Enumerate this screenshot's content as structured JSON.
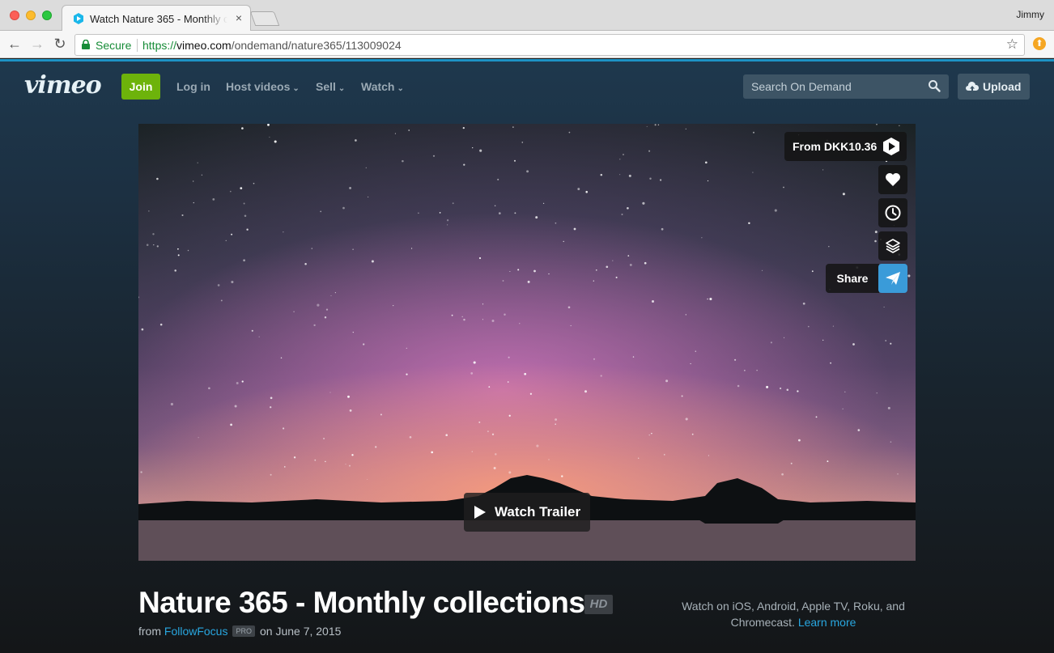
{
  "browser": {
    "tab_title": "Watch Nature 365 - Monthly collections",
    "tab_close": "×",
    "profile_name": "Jimmy",
    "secure_label": "Secure",
    "url_scheme": "https://",
    "url_host": "vimeo.com",
    "url_path": "/ondemand/nature365/113009024"
  },
  "header": {
    "logo": "vimeo",
    "join_label": "Join",
    "nav": [
      {
        "label": "Log in"
      },
      {
        "label": "Host videos"
      },
      {
        "label": "Sell"
      },
      {
        "label": "Watch"
      }
    ],
    "search_placeholder": "Search On Demand",
    "upload_label": "Upload"
  },
  "player": {
    "buy_label": "From DKK10.36",
    "share_label": "Share",
    "trailer_label": "Watch Trailer"
  },
  "video": {
    "title": "Nature 365 - Monthly collections",
    "quality_badge": "HD",
    "from_label": "from",
    "uploader": "FollowFocus",
    "pro_badge": "PRO",
    "date": "on June 7, 2015",
    "platforms_text": "Watch on iOS, Android, Apple TV, Roku, and Chromecast.",
    "learn_more": "Learn more"
  },
  "colors": {
    "accent": "#1d94c6",
    "join_green": "#6db30b",
    "share_blue": "#3a9bd9",
    "link_blue": "#28a7e0"
  }
}
